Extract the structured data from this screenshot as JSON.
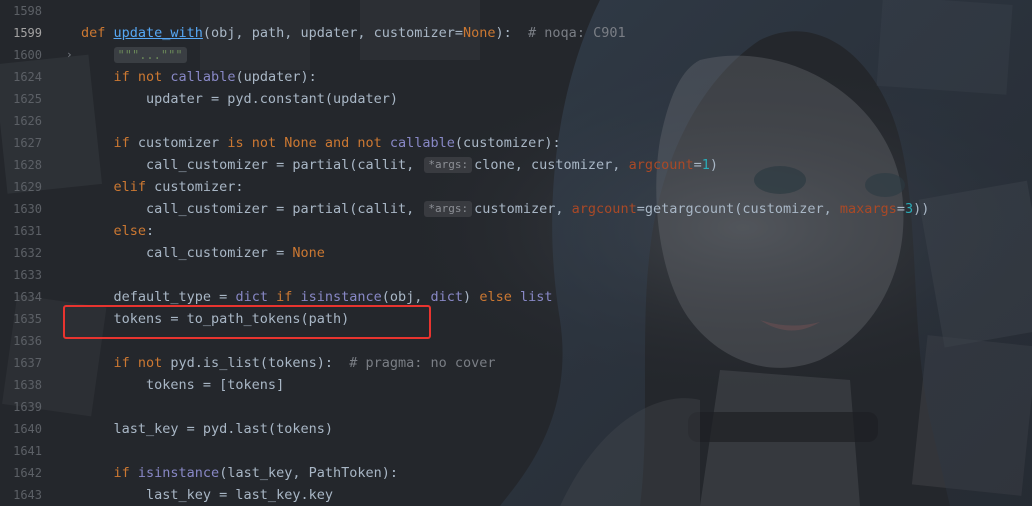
{
  "editor": {
    "lines": [
      {
        "n": "1598",
        "html": ""
      },
      {
        "n": "1599",
        "current": true,
        "segments": [
          [
            "kw",
            "def "
          ],
          [
            "fn-def",
            "update_with"
          ],
          [
            "p",
            "(obj, path, updater, customizer="
          ],
          [
            "const",
            "None"
          ],
          [
            "p",
            "):  "
          ],
          [
            "comment",
            "# noqa: C901"
          ]
        ]
      },
      {
        "n": "1600",
        "fold": "›",
        "segments": [
          [
            "p",
            "    "
          ],
          [
            "folded",
            "\"\"\"...\"\"\""
          ]
        ]
      },
      {
        "n": "1624",
        "segments": [
          [
            "p",
            "    "
          ],
          [
            "kw",
            "if not "
          ],
          [
            "builtin",
            "callable"
          ],
          [
            "p",
            "(updater):"
          ]
        ]
      },
      {
        "n": "1625",
        "segments": [
          [
            "p",
            "        updater = pyd.constant(updater)"
          ]
        ]
      },
      {
        "n": "1626",
        "segments": []
      },
      {
        "n": "1627",
        "segments": [
          [
            "p",
            "    "
          ],
          [
            "kw",
            "if "
          ],
          [
            "p",
            "customizer "
          ],
          [
            "kw",
            "is not "
          ],
          [
            "const",
            "None "
          ],
          [
            "kw",
            "and not "
          ],
          [
            "builtin",
            "callable"
          ],
          [
            "p",
            "(customizer):"
          ]
        ]
      },
      {
        "n": "1628",
        "segments": [
          [
            "p",
            "        call_customizer = partial(callit, "
          ],
          [
            "hint",
            "*args:"
          ],
          [
            "p",
            "clone, customizer, "
          ],
          [
            "kwarg",
            "argcount"
          ],
          [
            "p",
            "="
          ],
          [
            "num",
            "1"
          ],
          [
            "p",
            ")"
          ]
        ]
      },
      {
        "n": "1629",
        "segments": [
          [
            "p",
            "    "
          ],
          [
            "kw",
            "elif "
          ],
          [
            "p",
            "customizer:"
          ]
        ]
      },
      {
        "n": "1630",
        "segments": [
          [
            "p",
            "        call_customizer = partial(callit, "
          ],
          [
            "hint",
            "*args:"
          ],
          [
            "p",
            "customizer, "
          ],
          [
            "kwarg",
            "argcount"
          ],
          [
            "p",
            "=getargcount(customizer, "
          ],
          [
            "kwarg",
            "maxargs"
          ],
          [
            "p",
            "="
          ],
          [
            "num",
            "3"
          ],
          [
            "p",
            "))"
          ]
        ]
      },
      {
        "n": "1631",
        "segments": [
          [
            "p",
            "    "
          ],
          [
            "kw",
            "else"
          ],
          [
            "p",
            ":"
          ]
        ]
      },
      {
        "n": "1632",
        "segments": [
          [
            "p",
            "        call_customizer = "
          ],
          [
            "const",
            "None"
          ]
        ]
      },
      {
        "n": "1633",
        "segments": []
      },
      {
        "n": "1634",
        "segments": [
          [
            "p",
            "    default_type = "
          ],
          [
            "builtin",
            "dict "
          ],
          [
            "kw",
            "if "
          ],
          [
            "builtin",
            "isinstance"
          ],
          [
            "p",
            "(obj, "
          ],
          [
            "builtin",
            "dict"
          ],
          [
            "p",
            ") "
          ],
          [
            "kw",
            "else "
          ],
          [
            "builtin",
            "list"
          ]
        ]
      },
      {
        "n": "1635",
        "segments": [
          [
            "p",
            "    tokens = to_path_tokens(path)"
          ]
        ]
      },
      {
        "n": "1636",
        "segments": []
      },
      {
        "n": "1637",
        "segments": [
          [
            "p",
            "    "
          ],
          [
            "kw",
            "if not "
          ],
          [
            "p",
            "pyd.is_list(tokens):  "
          ],
          [
            "comment",
            "# pragma: no cover"
          ]
        ]
      },
      {
        "n": "1638",
        "segments": [
          [
            "p",
            "        tokens = [tokens]"
          ]
        ]
      },
      {
        "n": "1639",
        "segments": []
      },
      {
        "n": "1640",
        "segments": [
          [
            "p",
            "    last_key = pyd.last(tokens)"
          ]
        ]
      },
      {
        "n": "1641",
        "segments": []
      },
      {
        "n": "1642",
        "segments": [
          [
            "p",
            "    "
          ],
          [
            "kw",
            "if "
          ],
          [
            "builtin",
            "isinstance"
          ],
          [
            "p",
            "(last_key, PathToken):"
          ]
        ]
      },
      {
        "n": "1643",
        "segments": [
          [
            "p",
            "        last_key = last_key.key"
          ]
        ]
      }
    ]
  },
  "colors": {
    "highlight_box": "#e8342f",
    "keyword": "#cc7832",
    "function": "#56a8f5",
    "builtin": "#8888c6"
  }
}
